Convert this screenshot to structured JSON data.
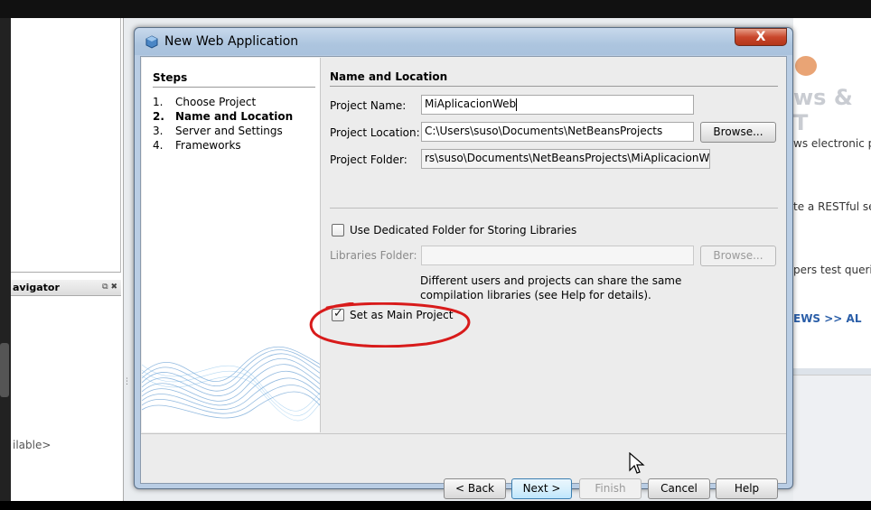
{
  "background": {
    "navigator_title": "avigator",
    "navigator_controls": "⧉ ✖",
    "available_text": "ilable>",
    "news_heading": "ws & T",
    "news_lines": [
      "ws electronic pa",
      "te a RESTful se",
      "pers test querie"
    ],
    "news_link": "EWS >>   AL"
  },
  "dialog": {
    "title": "New Web Application",
    "close_label": "X",
    "steps_title": "Steps",
    "steps": [
      {
        "num": "1.",
        "label": "Choose Project"
      },
      {
        "num": "2.",
        "label": "Name and Location"
      },
      {
        "num": "3.",
        "label": "Server and Settings"
      },
      {
        "num": "4.",
        "label": "Frameworks"
      }
    ],
    "section_title": "Name and Location",
    "project_name_label": "Project Name:",
    "project_name_value": "MiAplicacionWeb",
    "project_location_label": "Project Location:",
    "project_location_value": "C:\\Users\\suso\\Documents\\NetBeansProjects",
    "browse_label": "Browse...",
    "project_folder_label": "Project Folder:",
    "project_folder_value": "rs\\suso\\Documents\\NetBeansProjects\\MiAplicacionWeb",
    "dedicated_folder_label": "Use Dedicated Folder for Storing Libraries",
    "dedicated_folder_checked": false,
    "libraries_folder_label": "Libraries Folder:",
    "libraries_folder_value": "",
    "libraries_browse_label": "Browse...",
    "help_line1": "Different users and projects can share the same",
    "help_line2": "compilation libraries (see Help for details).",
    "main_project_label": "Set as Main Project",
    "main_project_checked": true,
    "buttons": {
      "back": "< Back",
      "next": "Next >",
      "finish": "Finish",
      "cancel": "Cancel",
      "help": "Help"
    }
  }
}
